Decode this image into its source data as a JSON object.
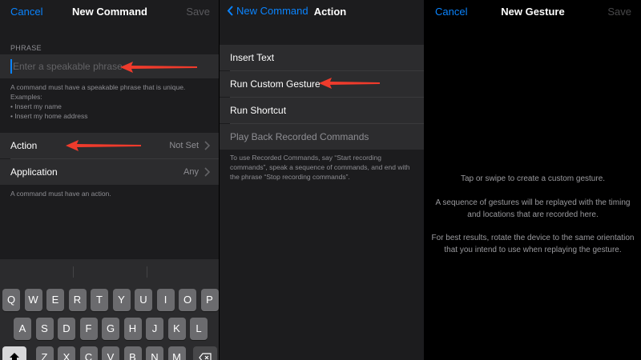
{
  "panel1": {
    "nav": {
      "left": "Cancel",
      "title": "New Command",
      "right": "Save"
    },
    "phrase_label": "PHRASE",
    "phrase_placeholder": "Enter a speakable phrase",
    "phrase_hint": [
      "A command must have a speakable phrase that is unique.",
      "Examples:",
      "• Insert my name",
      "• Insert my home address"
    ],
    "action": {
      "label": "Action",
      "value": "Not Set"
    },
    "application": {
      "label": "Application",
      "value": "Any"
    },
    "action_hint": "A command must have an action.",
    "keyboard": {
      "row1": [
        "Q",
        "W",
        "E",
        "R",
        "T",
        "Y",
        "U",
        "I",
        "O",
        "P"
      ],
      "row2": [
        "A",
        "S",
        "D",
        "F",
        "G",
        "H",
        "J",
        "K",
        "L"
      ],
      "row3": [
        "Z",
        "X",
        "C",
        "V",
        "B",
        "N",
        "M"
      ]
    }
  },
  "panel2": {
    "nav": {
      "back": "New Command",
      "title": "Action"
    },
    "items": [
      "Insert Text",
      "Run Custom Gesture",
      "Run Shortcut",
      "Play Back Recorded Commands"
    ],
    "footer": [
      "To use Recorded Commands, say “Start recording",
      "commands”, speak a sequence of commands, and end with",
      "the phrase “Stop recording commands”."
    ]
  },
  "panel3": {
    "nav": {
      "left": "Cancel",
      "title": "New Gesture",
      "right": "Save"
    },
    "paragraphs": [
      [
        "Tap or swipe to create a custom gesture."
      ],
      [
        "A sequence of gestures will be replayed with the timing",
        "and locations that are recorded here."
      ],
      [
        "For best results, rotate the device to the same orientation",
        "that you intend to use when replaying the gesture."
      ]
    ]
  },
  "colors": {
    "accent": "#0a84ff",
    "arrow": "#ef3b2c",
    "cell": "#2c2c2e",
    "background": "#1c1c1e"
  },
  "icons": [
    "chevron-right-icon",
    "chevron-left-icon",
    "shift-icon",
    "backspace-icon",
    "red-arrow-icon"
  ]
}
